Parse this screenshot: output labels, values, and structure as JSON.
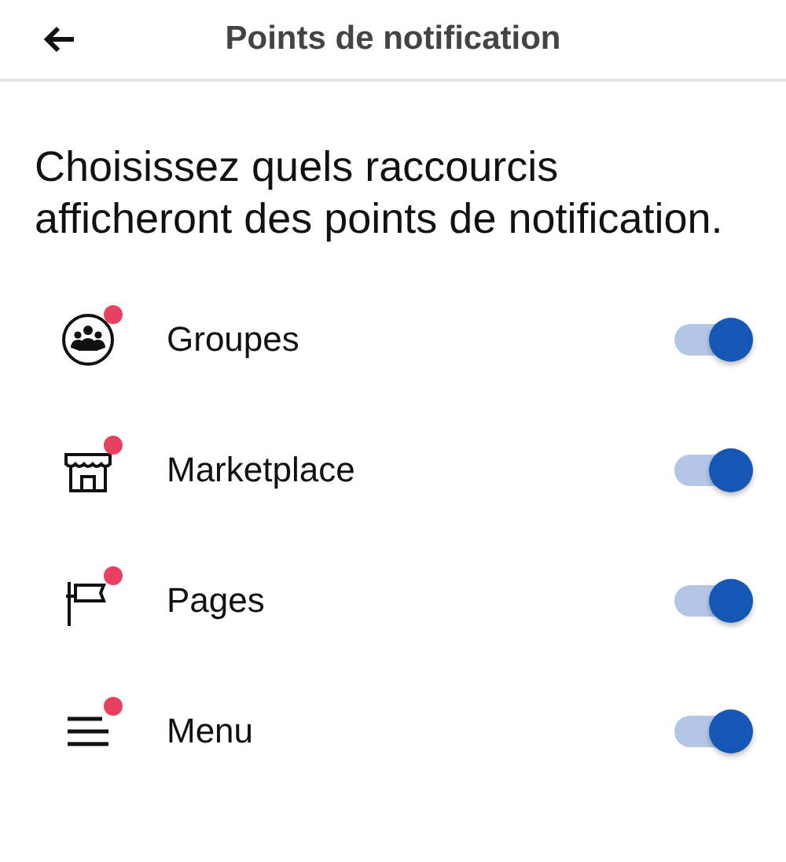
{
  "header": {
    "title": "Points de notification"
  },
  "description": "Choisissez quels raccourcis afficheront des points de notification.",
  "shortcuts": [
    {
      "kind": "groups",
      "label": "Groupes",
      "dot": true,
      "on": true
    },
    {
      "kind": "store",
      "label": "Marketplace",
      "dot": true,
      "on": true
    },
    {
      "kind": "flag",
      "label": "Pages",
      "dot": true,
      "on": true
    },
    {
      "kind": "menu",
      "label": "Menu",
      "dot": true,
      "on": true
    }
  ]
}
